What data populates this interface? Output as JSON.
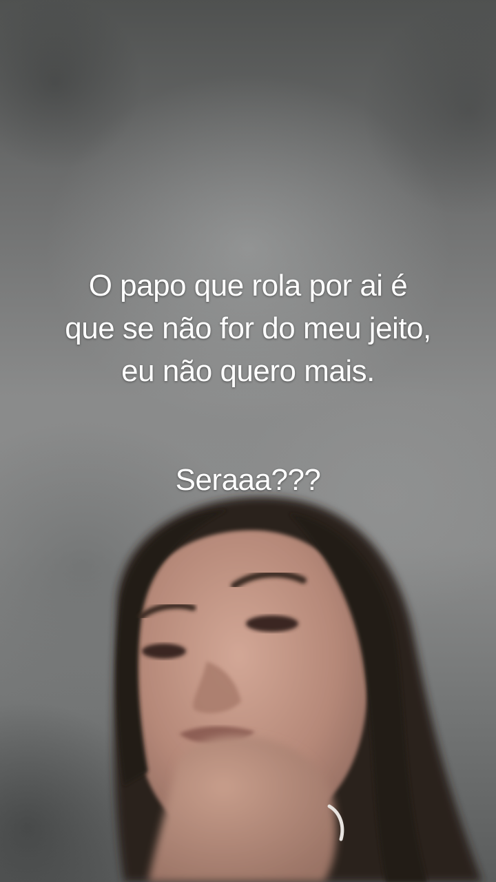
{
  "caption": {
    "lines": [
      "O papo que rola por ai é",
      "que se não for do meu jeito,",
      "eu não quero mais."
    ],
    "tag": "Seraaa???"
  },
  "colors": {
    "caption_text": "#ffffff",
    "wall": "#8a8b8b",
    "hair": "#2a201c",
    "skin": "#b88e7d"
  }
}
